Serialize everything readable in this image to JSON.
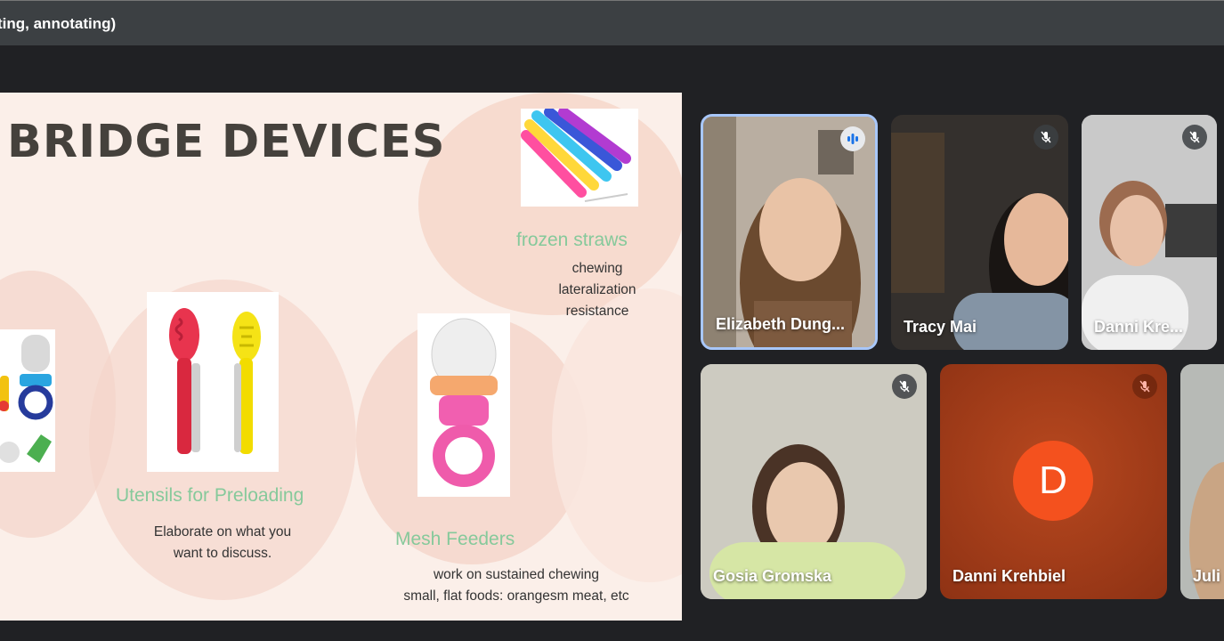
{
  "window": {
    "title": "ting, annotating)"
  },
  "slide": {
    "title": "BRIDGE DEVICES",
    "sections": {
      "frozen_straws": {
        "heading": "frozen straws",
        "lines": [
          "chewing",
          "lateralization",
          "resistance"
        ]
      },
      "utensils": {
        "heading": "Utensils for Preloading",
        "lines": [
          "Elaborate on what you",
          "want to discuss."
        ]
      },
      "mesh": {
        "heading": "Mesh Feeders",
        "lines": [
          "work on sustained chewing",
          "small, flat foods: orangesm meat, etc"
        ]
      }
    }
  },
  "participants": [
    {
      "name": "Elizabeth Dung...",
      "status": "speaking-icon"
    },
    {
      "name": "Tracy Mai",
      "status": "mic-off-icon"
    },
    {
      "name": "Danni Kre...",
      "status": "mic-off-icon"
    },
    {
      "name": "Gosia Gromska",
      "status": "mic-off-icon"
    },
    {
      "name": "Danni Krehbiel",
      "status": "mic-off-icon",
      "avatar_letter": "D"
    },
    {
      "name": "Juli"
    }
  ],
  "colors": {
    "accent_speaking": "#8ab4f8",
    "avatar_bg": "#f4511e",
    "slide_green": "#86c99b"
  }
}
